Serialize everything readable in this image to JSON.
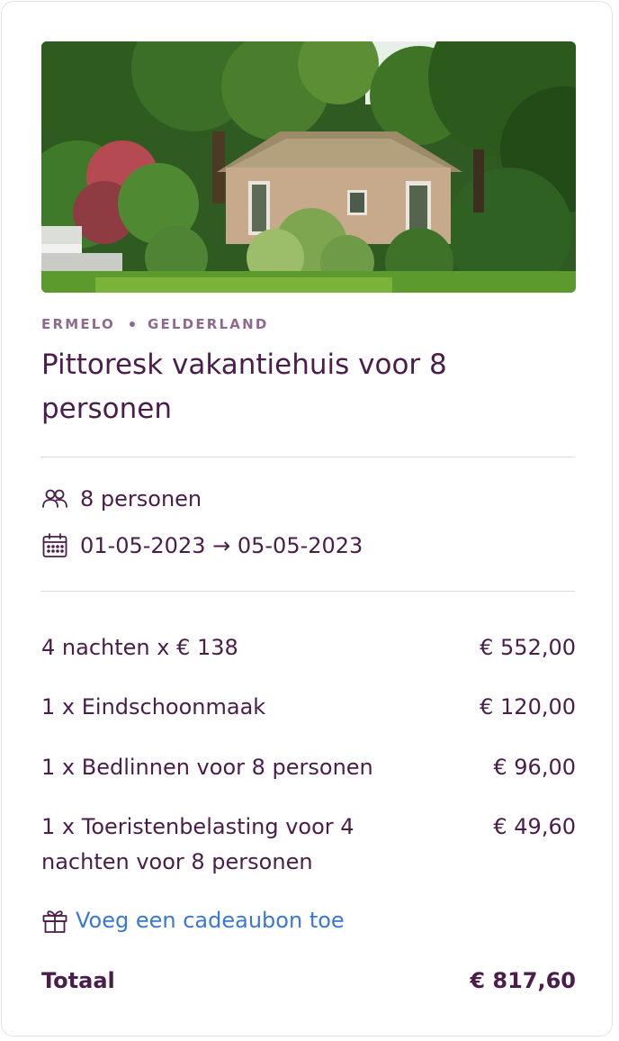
{
  "location": {
    "city": "ERMELO",
    "province": "GELDERLAND"
  },
  "title": "Pittoresk vakantiehuis voor 8 personen",
  "guests": {
    "icon": "people-icon",
    "label": "8 personen"
  },
  "dates": {
    "icon": "calendar-icon",
    "label": "01-05-2023 → 05-05-2023"
  },
  "line_items": [
    {
      "label": "4 nachten x € 138",
      "amount": "€ 552,00"
    },
    {
      "label": "1 x Eindschoonmaak",
      "amount": "€ 120,00"
    },
    {
      "label": "1 x Bedlinnen voor 8 personen",
      "amount": "€ 96,00"
    },
    {
      "label": "1 x Toeristenbelasting voor 4 nachten voor 8 personen",
      "amount": "€ 49,60"
    }
  ],
  "gift": {
    "icon": "gift-icon",
    "label": "Voeg een cadeaubon toe"
  },
  "total": {
    "label": "Totaal",
    "amount": "€ 817,60"
  },
  "colors": {
    "text": "#4a1d4a",
    "muted": "#8e6a8e",
    "link": "#3a78d4",
    "divider": "#dcdcdc"
  }
}
